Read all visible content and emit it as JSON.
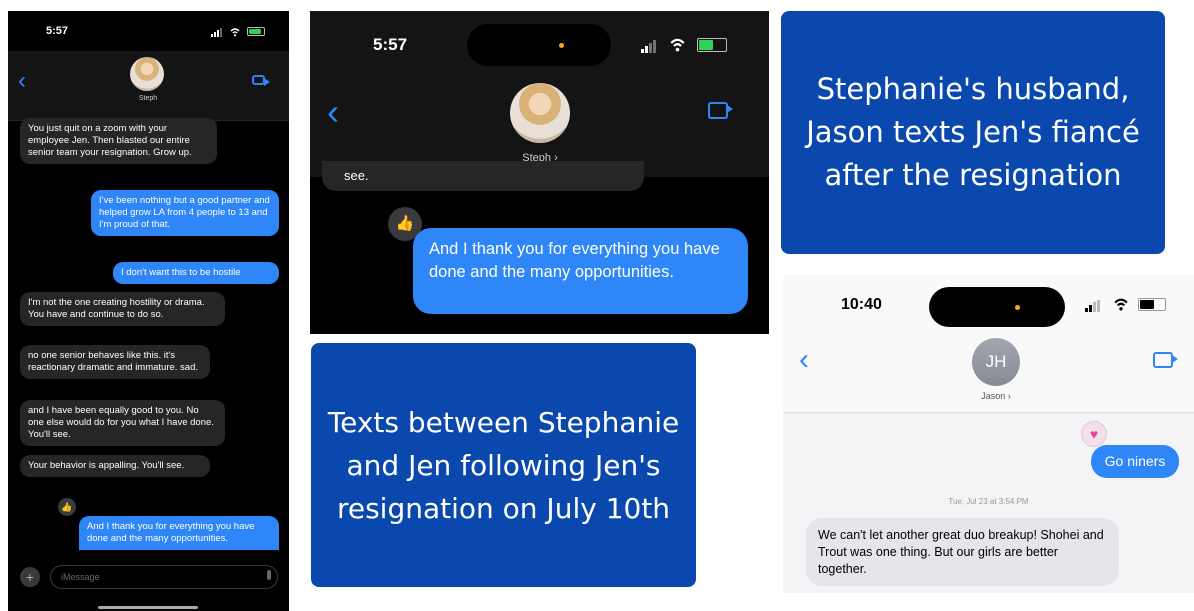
{
  "panel1": {
    "time": "5:57",
    "contact_name": "Steph",
    "messages": [
      {
        "dir": "in",
        "text": "You just quit on a zoom with your employee Jen. Then blasted our entire senior team your resignation. Grow up."
      },
      {
        "dir": "out",
        "text": "I've been nothing but a good partner and helped grow LA from 4 people to 13 and I'm proud of that."
      },
      {
        "dir": "out",
        "text": "I don't want this to be hostile"
      },
      {
        "dir": "in",
        "text": "I'm not the one creating hostility or drama. You have and continue to do so."
      },
      {
        "dir": "in",
        "text": "no one senior behaves like this. it's reactionary dramatic and immature. sad."
      },
      {
        "dir": "in",
        "text": "and I have been equally good to you. No one else would do for you what I have done. You'll see."
      },
      {
        "dir": "in",
        "text": "Your behavior is appalling. You'll see."
      },
      {
        "dir": "out",
        "text": "And I thank you for everything you have done and the many opportunities."
      }
    ],
    "composer_placeholder": "iMessage",
    "plus_label": "+"
  },
  "panel2": {
    "time": "5:57",
    "contact_name": "Steph ›",
    "partial_text": "see.",
    "message": "And I thank you for everything you have done and the many opportunities."
  },
  "caption_left": "Texts between Stephanie and Jen following Jen's resignation on July 10th",
  "caption_right": "Stephanie's husband, Jason texts Jen's fiancé after the resignation",
  "panel3": {
    "time": "10:40",
    "initials": "JH",
    "contact_name": "Jason ›",
    "outgoing": "Go niners",
    "timestamp": "Tue, Jul 23 at 3:54 PM",
    "incoming": "We can't let another great duo breakup! Shohei and Trout was one thing.  But our girls are better together."
  },
  "icons": {
    "back": "‹",
    "thumbs_up": "👍",
    "heart": "♥"
  },
  "colors": {
    "imessage_blue": "#2f86f6",
    "caption_blue": "#0a48ad",
    "dark_bubble": "#262628",
    "light_bubble": "#e5e5ea"
  }
}
